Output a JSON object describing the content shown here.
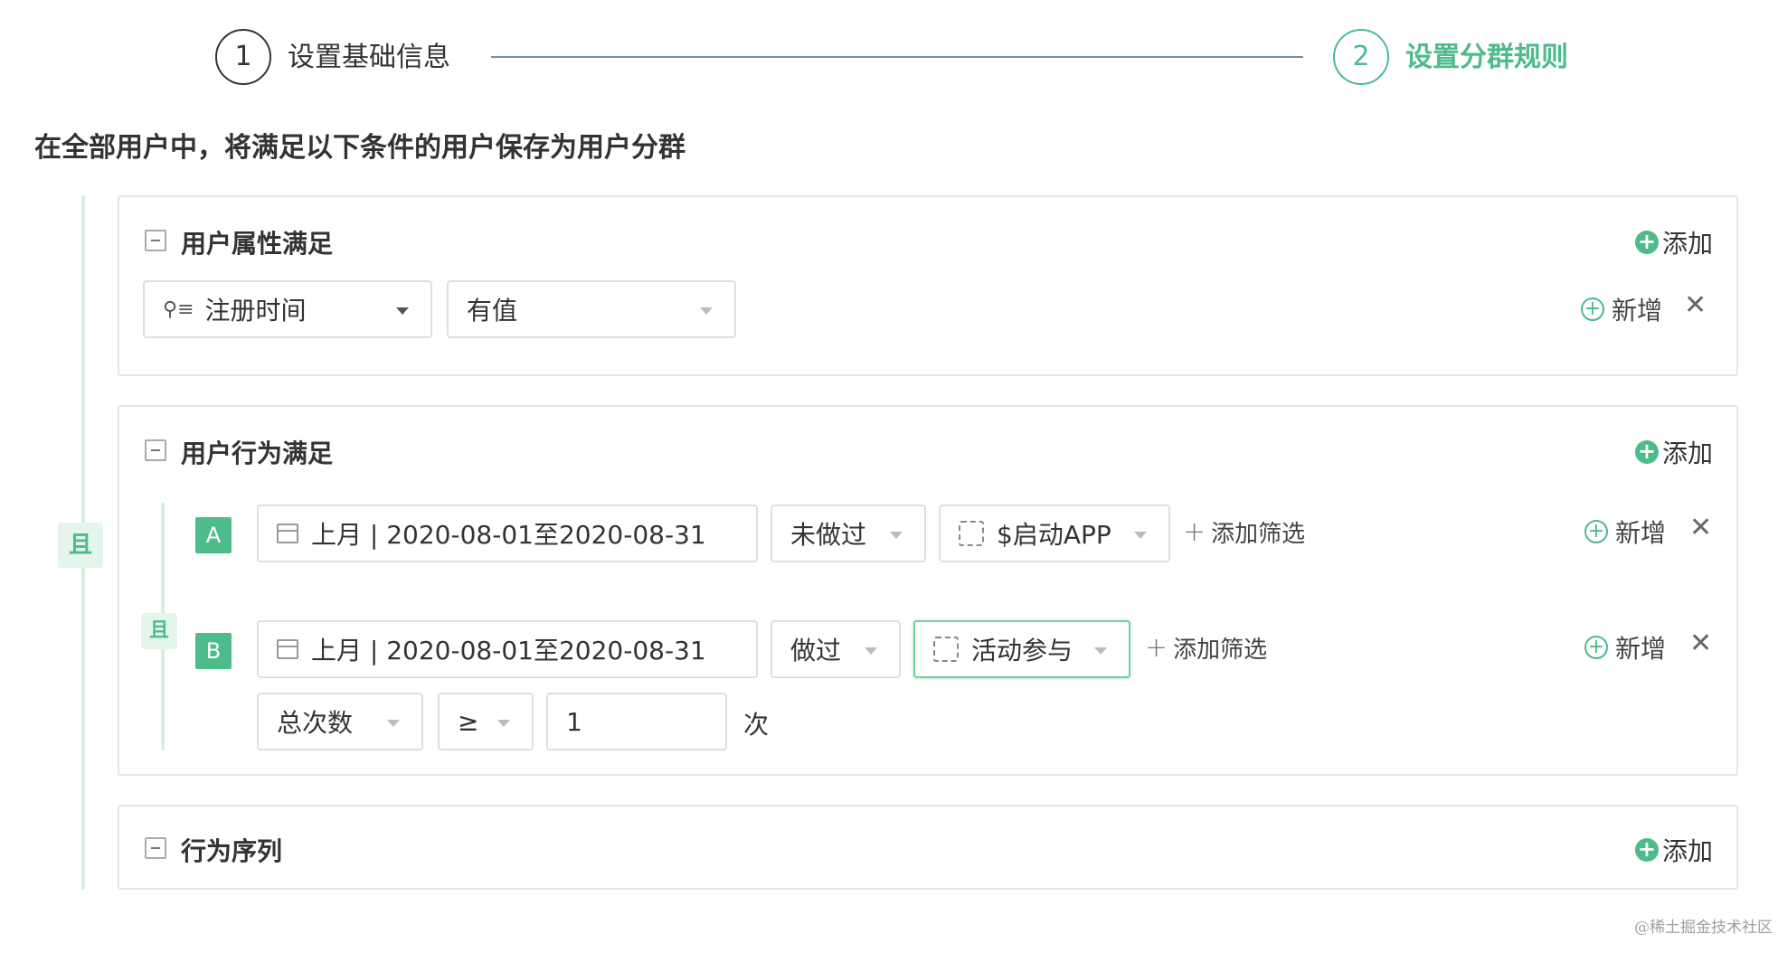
{
  "steps": [
    {
      "number": "1",
      "label": "设置基础信息"
    },
    {
      "number": "2",
      "label": "设置分群规则"
    }
  ],
  "intro": "在全部用户中，将满足以下条件的用户保存为用户分群",
  "and_label": "且",
  "icons": {
    "user_attr": "user-attribute-icon",
    "calendar": "calendar-icon",
    "event": "event-icon"
  },
  "colors": {
    "accent": "#4dbb8a",
    "border": "#dcdfe6"
  },
  "attr_card": {
    "title": "用户属性满足",
    "add_label": "添加",
    "row": {
      "property": "注册时间",
      "operator": "有值",
      "new_label": "新增"
    }
  },
  "behavior_card": {
    "title": "用户行为满足",
    "add_label": "添加",
    "rows": [
      {
        "tag": "A",
        "date": "上月 |  2020-08-01至2020-08-31",
        "action": "未做过",
        "event": "$启动APP",
        "filter_label": "添加筛选",
        "new_label": "新增"
      },
      {
        "tag": "B",
        "date": "上月 |  2020-08-01至2020-08-31",
        "action": "做过",
        "event": "活动参与",
        "filter_label": "添加筛选",
        "new_label": "新增",
        "metric": "总次数",
        "compare": "≥",
        "value": "1",
        "unit": "次"
      }
    ]
  },
  "sequence_card": {
    "title": "行为序列",
    "add_label": "添加"
  },
  "watermark": "@稀土掘金技术社区"
}
